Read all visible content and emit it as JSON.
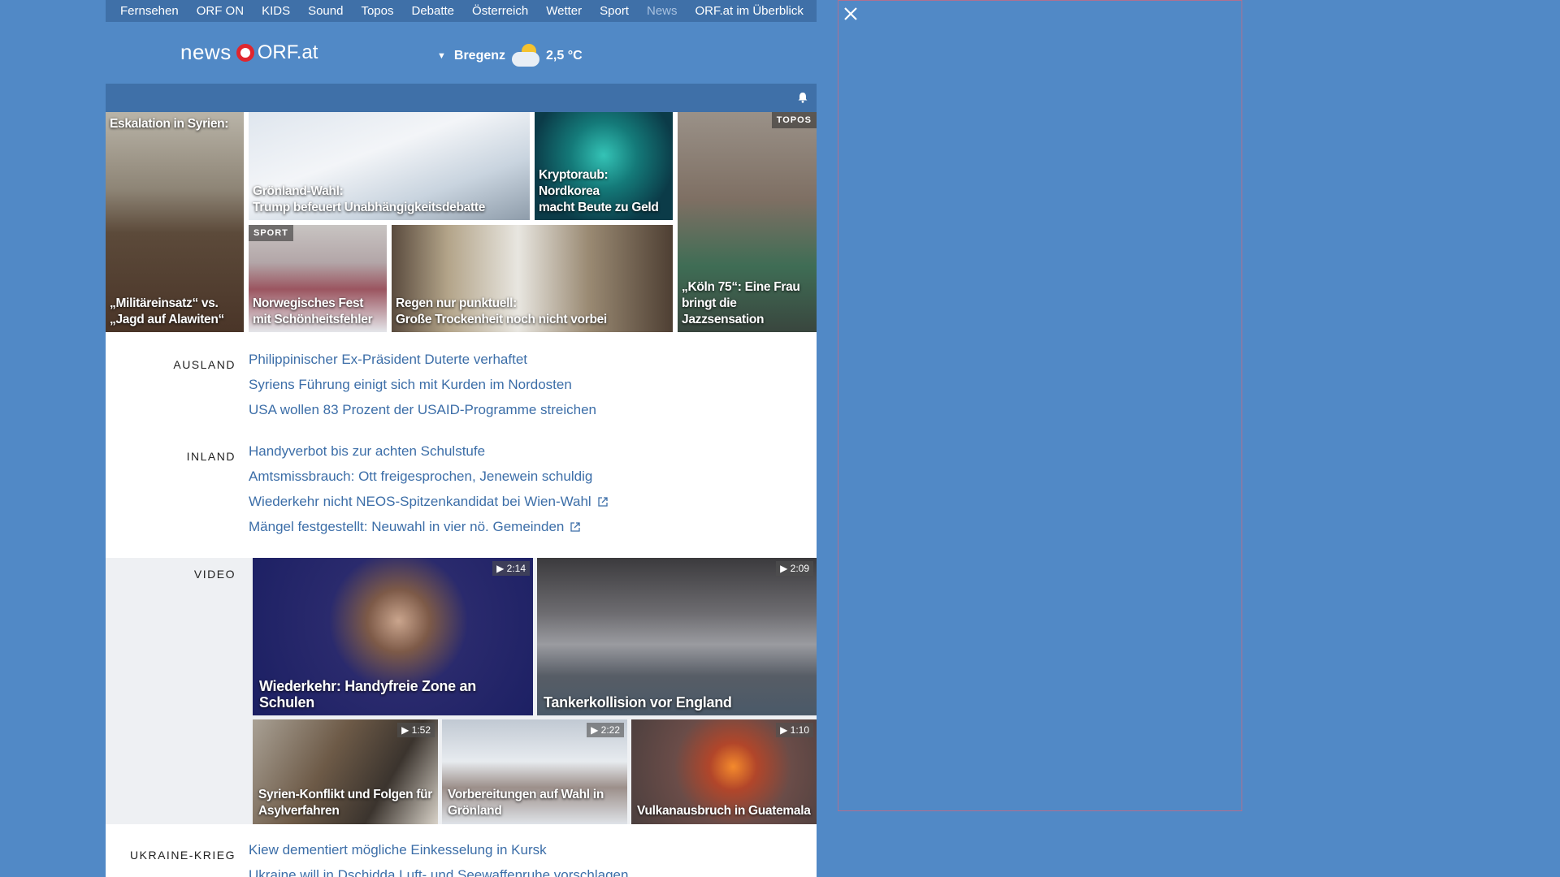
{
  "nav": {
    "items": [
      "Fernsehen",
      "ORF ON",
      "KIDS",
      "Sound",
      "Topos",
      "Debatte",
      "Österreich",
      "Wetter",
      "Sport",
      "News"
    ],
    "overview": "ORF.at im Überblick"
  },
  "logo": {
    "news": "news",
    "orf": "ORF.at"
  },
  "weather": {
    "location": "Bregenz",
    "temperature": "2,5 °C",
    "icon": "partly-cloudy-icon"
  },
  "tiles": [
    {
      "top": "Eskalation in Syrien:",
      "caption": "„Militäreinsatz“ vs.\n„Jagd auf Alawiten“"
    },
    {
      "caption": "Grönland-Wahl:\nTrump befeuert Unabhängigkeitsdebatte"
    },
    {
      "caption": "Kryptoraub: Nordkorea\nmacht Beute zu Geld"
    },
    {
      "tag": "TOPOS",
      "caption": "„Köln 75“: Eine Frau\nbringt die Jazzsensation"
    },
    {
      "tag": "SPORT",
      "caption": "Norwegisches Fest\nmit Schönheitsfehler"
    },
    {
      "caption": "Regen nur punktuell:\nGroße Trockenheit noch nicht vorbei"
    }
  ],
  "sections": {
    "ausland": {
      "label": "AUSLAND",
      "links": [
        "Philippinischer Ex-Präsident Duterte verhaftet",
        "Syriens Führung einigt sich mit Kurden im Nordosten",
        "USA wollen 83 Prozent der USAID-Programme streichen"
      ]
    },
    "inland": {
      "label": "INLAND",
      "links": [
        "Handyverbot bis zur achten Schulstufe",
        "Amtsmissbrauch: Ott freigesprochen, Jenewein schuldig",
        "Wiederkehr nicht NEOS-Spitzenkandidat bei Wien-Wahl",
        "Mängel festgestellt: Neuwahl in vier nö. Gemeinden"
      ]
    },
    "video": {
      "label": "VIDEO",
      "items": [
        {
          "duration": "▶ 2:14",
          "caption": "Wiederkehr: Handyfreie Zone an Schulen"
        },
        {
          "duration": "▶ 2:09",
          "caption": "Tankerkollision vor England"
        },
        {
          "duration": "▶ 1:52",
          "caption": "Syrien-Konflikt und Folgen für\nAsylverfahren"
        },
        {
          "duration": "▶ 2:22",
          "caption": "Vorbereitungen auf Wahl in\nGrönland"
        },
        {
          "duration": "▶ 1:10",
          "caption": "Vulkanausbruch in Guatemala"
        }
      ]
    },
    "ukraine": {
      "label": "UKRAINE-KRIEG",
      "links": [
        "Kiew dementiert mögliche Einkesselung in Kursk",
        "Ukraine will in Dschidda Luft- und Seewaffenruhe vorschlagen"
      ]
    }
  }
}
